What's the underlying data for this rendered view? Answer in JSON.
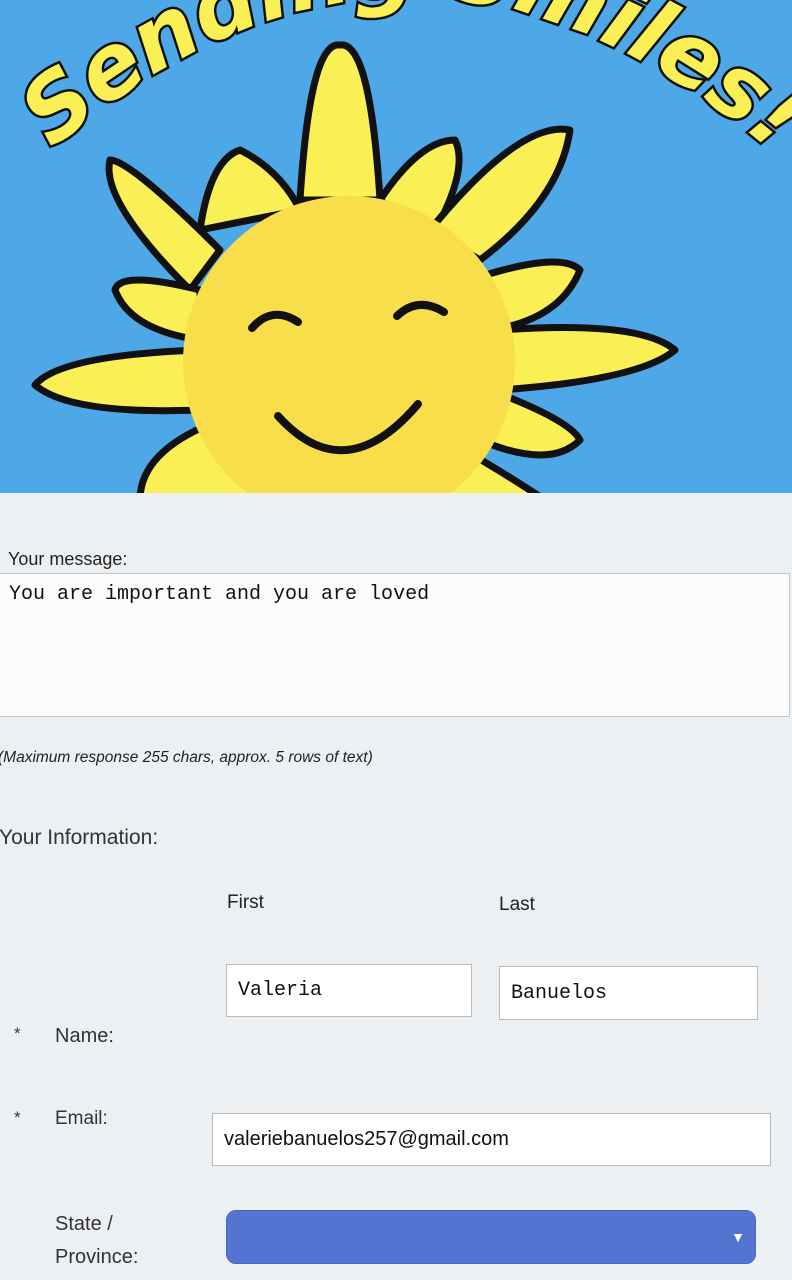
{
  "banner": {
    "title": "Sending Smiles!",
    "colors": {
      "sky": "#4ea7e6",
      "petal": "#fbef56",
      "face": "#f9de4b",
      "outline": "#111111"
    }
  },
  "message": {
    "label": "Your message:",
    "value": "You are important and you are loved",
    "hint": "(Maximum response 255 chars, approx. 5 rows of text)"
  },
  "info": {
    "title": "Your Information:",
    "first_header": "First",
    "last_header": "Last",
    "first_value": "Valeria",
    "last_value": "Banuelos",
    "required_mark": "*",
    "name_label": "Name:",
    "email_label": "Email:",
    "email_value": "valeriebanuelos257@gmail.com",
    "state_label_line1": "State /",
    "state_label_line2": "Province:",
    "state_value": "",
    "select_color": "#5573d0"
  }
}
